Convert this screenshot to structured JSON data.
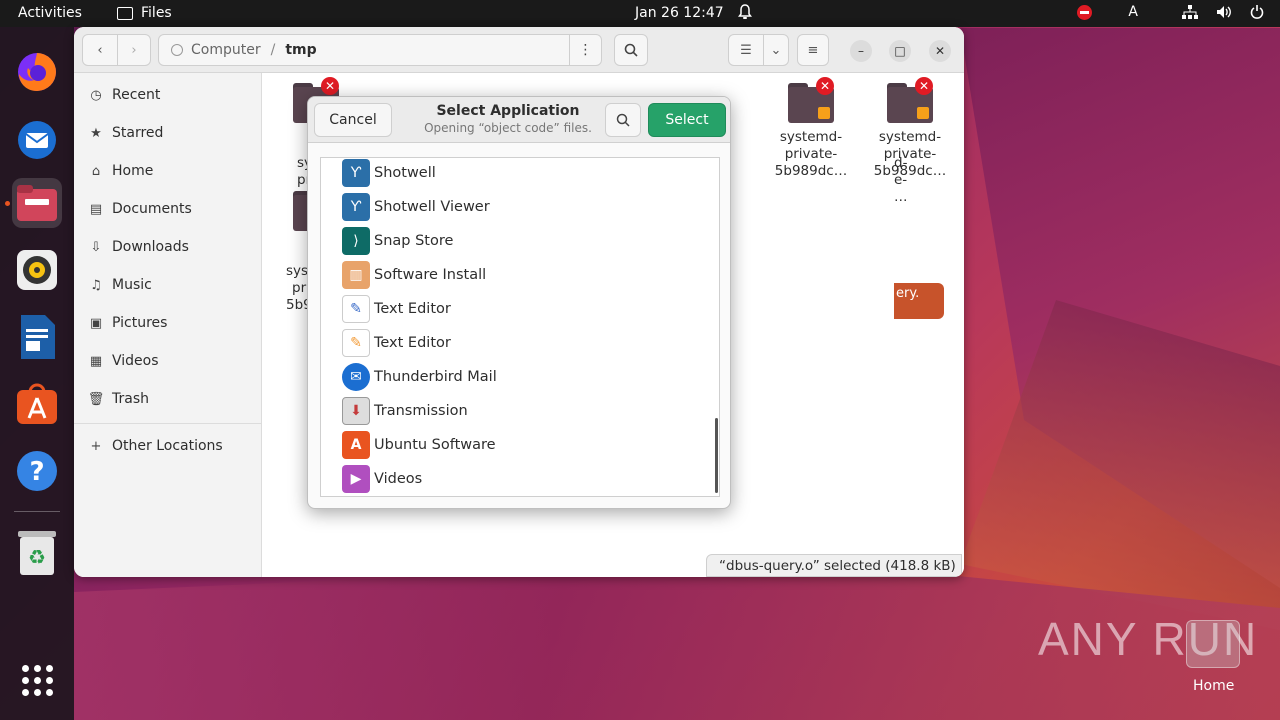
{
  "topbar": {
    "activities": "Activities",
    "app_name": "Files",
    "datetime": "Jan 26  12:47",
    "keyboard_indicator": "A"
  },
  "dock": {
    "items": [
      "firefox-icon",
      "thunderbird-icon",
      "files-icon",
      "rhythmbox-icon",
      "writer-icon",
      "software-icon",
      "help-icon",
      "trash-icon",
      "app-grid-icon"
    ]
  },
  "files_window": {
    "path": [
      "Computer",
      "tmp"
    ],
    "sidebar": [
      {
        "label": "Recent",
        "icon": "clock-icon"
      },
      {
        "label": "Starred",
        "icon": "star-icon"
      },
      {
        "label": "Home",
        "icon": "home-icon"
      },
      {
        "label": "Documents",
        "icon": "document-icon"
      },
      {
        "label": "Downloads",
        "icon": "download-icon"
      },
      {
        "label": "Music",
        "icon": "music-icon"
      },
      {
        "label": "Pictures",
        "icon": "picture-icon"
      },
      {
        "label": "Videos",
        "icon": "video-icon"
      },
      {
        "label": "Trash",
        "icon": "trash-icon"
      },
      {
        "label": "Other Locations",
        "icon": "plus-icon"
      }
    ],
    "folders": [
      {
        "line1": "systemd-",
        "line2": "private-",
        "line3": "5b989dc…"
      },
      {
        "line1": "systemd-",
        "line2": "private-",
        "line3": "5b989dc…"
      }
    ],
    "partial_labels": {
      "col1": [
        "sy",
        "pr",
        "b"
      ],
      "col1b": [
        "sys",
        "pr",
        "5b98"
      ],
      "col5": [
        "d-",
        "e-",
        "…"
      ],
      "tip": "ery."
    },
    "status": "“dbus-query.o” selected  (418.8 kB)"
  },
  "dialog": {
    "cancel": "Cancel",
    "title": "Select Application",
    "subtitle": "Opening “object code” files.",
    "select": "Select",
    "apps": [
      {
        "name": "Shotwell",
        "icon": "shotwell-icon",
        "color": "#2b6fa8"
      },
      {
        "name": "Shotwell Viewer",
        "icon": "shotwell-icon",
        "color": "#2b6fa8"
      },
      {
        "name": "Snap Store",
        "icon": "snap-store-icon",
        "color": "#0e6b66"
      },
      {
        "name": "Software Install",
        "icon": "package-icon",
        "color": "#e8a36a"
      },
      {
        "name": "Text Editor",
        "icon": "text-editor-icon",
        "color": "#3a6bc8"
      },
      {
        "name": "Text Editor",
        "icon": "text-editor-icon",
        "color": "#f29b38"
      },
      {
        "name": "Thunderbird Mail",
        "icon": "thunderbird-icon",
        "color": "#1b6ed1"
      },
      {
        "name": "Transmission",
        "icon": "transmission-icon",
        "color": "#c43b3b"
      },
      {
        "name": "Ubuntu Software",
        "icon": "ubuntu-software-icon",
        "color": "#e95420"
      },
      {
        "name": "Videos",
        "icon": "videos-icon",
        "color": "#b04fbf"
      }
    ]
  },
  "desktop": {
    "watermark": "ANY  RUN",
    "home_label": "Home"
  }
}
